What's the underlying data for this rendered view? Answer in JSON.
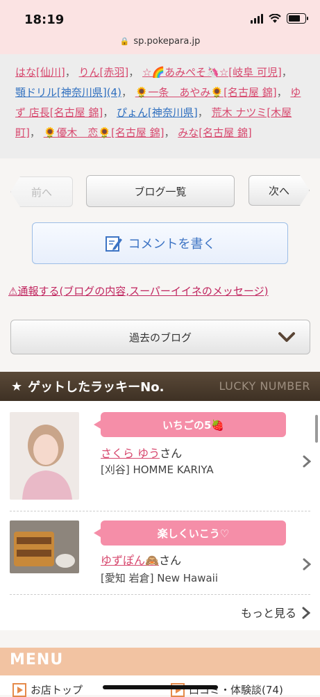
{
  "status": {
    "time": "18:19",
    "url": "sp.pokepara.jp"
  },
  "names": [
    {
      "text": "はな[仙川]",
      "color": "pink"
    },
    {
      "text": "りん[赤羽]",
      "color": "pink"
    },
    {
      "text": "☆🌈あみぺそ🦄☆[岐阜 可児]",
      "color": "pink"
    },
    {
      "text": "顎ドリル[神奈川県](4)",
      "color": "blue"
    },
    {
      "text": "🌻一条　あやみ🌻[名古屋 錦]",
      "color": "pink"
    },
    {
      "text": "ゆず 店長[名古屋 錦]",
      "color": "pink"
    },
    {
      "text": "ぴょん[神奈川県]",
      "color": "blue"
    },
    {
      "text": "荒木 ナツミ[木屋町]",
      "color": "pink"
    },
    {
      "text": "🌻優木　恋🌻[名古屋 錦]",
      "color": "pink"
    },
    {
      "text": "みな[名古屋 錦]",
      "color": "pink"
    }
  ],
  "nav": {
    "prev": "前へ",
    "list": "ブログ一覧",
    "next": "次へ"
  },
  "comment": "コメントを書く",
  "report": "⚠通報する(ブログの内容,スーパーイイネのメッセージ)",
  "past_blog": "過去のブログ",
  "lucky": {
    "title": "ゲットしたラッキーNo.",
    "title_en": "LUCKY NUMBER",
    "items": [
      {
        "bubble": "いちごの5🍓",
        "name": "さくら ゆう",
        "suffix": "さん",
        "shop": "[刈谷] HOMME KARIYA"
      },
      {
        "bubble": "楽しくいこう♡",
        "name": "ゆずぽん🙈",
        "suffix": "さん",
        "shop": "[愛知 岩倉] New Hawaii"
      }
    ],
    "more": "もっと見る"
  },
  "menu": {
    "title": "MENU",
    "items": [
      {
        "label": "お店トップ"
      },
      {
        "label": "口コミ・体験談(74)"
      }
    ]
  },
  "colors": {
    "pink_link": "#d7486e",
    "blue_link": "#2f6fbf",
    "bubble": "#f58ea8",
    "header_brown": "#4a3b2c",
    "menu_orange": "#f2c3a2"
  }
}
